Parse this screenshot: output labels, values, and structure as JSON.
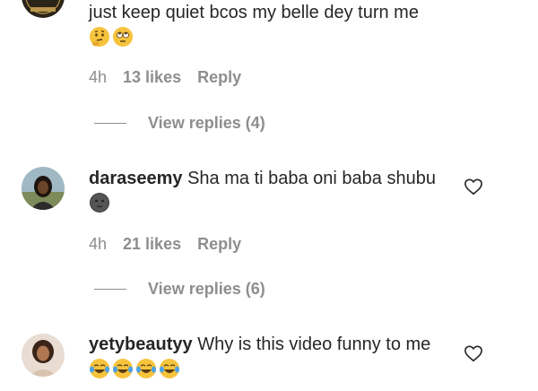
{
  "comments": [
    {
      "username": "",
      "text": "just keep quiet bcos my belle dey turn me",
      "emojis": [
        "thinking-face",
        "face-with-rolling-eyes"
      ],
      "time": "4h",
      "likes": "13 likes",
      "reply": "Reply",
      "view_replies": "View replies (4)"
    },
    {
      "username": "daraseemy",
      "text": "Sha ma ti baba oni baba shubu",
      "emojis": [
        "new-moon-face"
      ],
      "time": "4h",
      "likes": "21 likes",
      "reply": "Reply",
      "view_replies": "View replies (6)"
    },
    {
      "username": "yetybeautyy",
      "text": "Why is this video funny to me",
      "emojis": [
        "face-with-tears-of-joy",
        "face-with-tears-of-joy",
        "face-with-tears-of-joy",
        "face-with-tears-of-joy"
      ]
    }
  ],
  "colors": {
    "text": "#262626",
    "muted": "#8e8e8e",
    "background": "#ffffff"
  }
}
